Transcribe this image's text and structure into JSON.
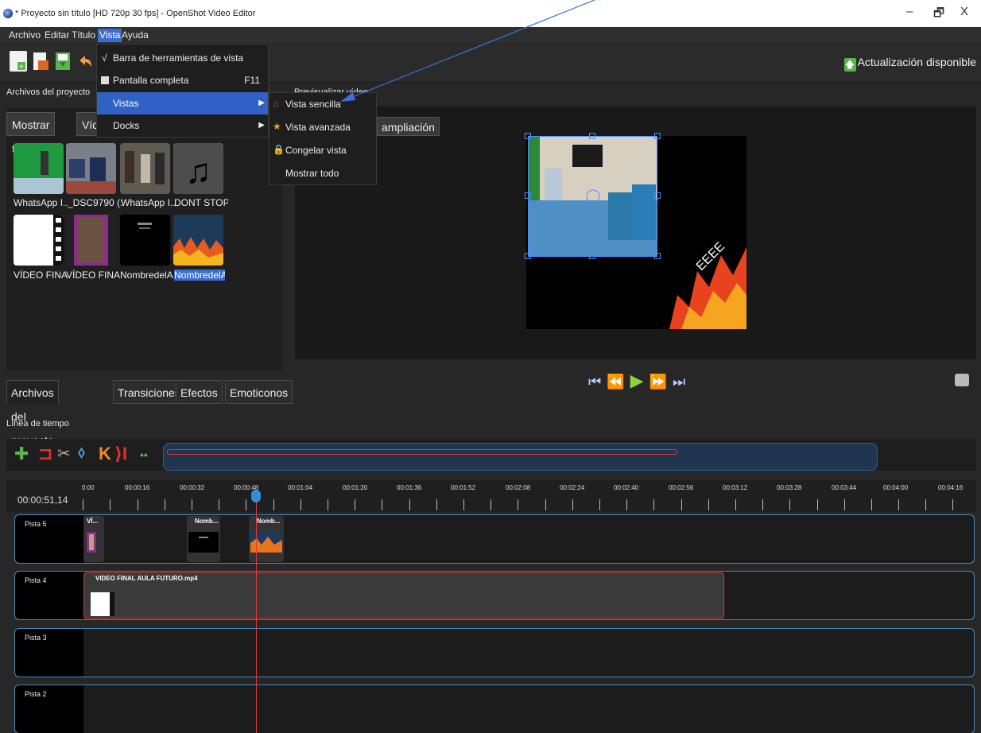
{
  "window": {
    "title": "* Proyecto sin título [HD 720p 30 fps] - OpenShot Video Editor",
    "minimize": "–",
    "restore": "🗗",
    "close": "X"
  },
  "menu": {
    "archivo": "Archivo",
    "editar": "Editar",
    "titulo": "Título",
    "vista": "Vista",
    "ayuda": "Ayuda"
  },
  "toolbar": {
    "update_label": "Actualización disponible"
  },
  "docks": {
    "project_files_title": "Archivos del proyecto",
    "preview_title": "Previsualizar vídeo",
    "timeline_title": "Línea de tiempo"
  },
  "filters": {
    "show_all": "Mostrar todo",
    "video": "Víde"
  },
  "files": [
    {
      "label": "WhatsApp I..."
    },
    {
      "label": "_DSC9790 (1..."
    },
    {
      "label": "WhatsApp I..."
    },
    {
      "label": "DONT STOP ..."
    },
    {
      "label": "VÍDEO FINAL..."
    },
    {
      "label": "VÍDEO FINAL..."
    },
    {
      "label": "NombredelA..."
    },
    {
      "label": "NombredelA..."
    }
  ],
  "bottom_tabs": {
    "project_files": "Archivos del proyecto",
    "transitions": "Transiciones",
    "effects": "Efectos",
    "emoticons": "Emoticonos"
  },
  "preview": {
    "zoom_label": "ampliación"
  },
  "vista_menu": {
    "toolbar_item": "Barra de herramientas de vista",
    "toolbar_check": "√",
    "fullscreen": "Pantalla completa",
    "fullscreen_shortcut": "F11",
    "views": "Vistas",
    "docks": "Docks"
  },
  "vistas_submenu": {
    "simple": "Vista sencilla",
    "advanced": "Vista avanzada",
    "freeze": "Congelar vista",
    "show_all": "Mostrar todo"
  },
  "timeline": {
    "current_time": "00:00:51,14",
    "ticks": [
      "0:00",
      "00:00:16",
      "00:00:32",
      "00:00:48",
      "00:01:04",
      "00:01:20",
      "00:01:36",
      "00:01:52",
      "00:02:08",
      "00:02:24",
      "00:02:40",
      "00:02:56",
      "00:03:12",
      "00:03:28",
      "00:03:44",
      "00:04:00",
      "00:04:16"
    ],
    "tracks": [
      {
        "name": "Pista 5"
      },
      {
        "name": "Pista 4"
      },
      {
        "name": "Pista 3"
      },
      {
        "name": "Pista 2"
      }
    ],
    "clips": {
      "t5_a": "VÍ...",
      "t5_b": "Nomb...",
      "t5_c": "Nomb...",
      "t4_main": "VIDEO FINAL AULA FUTURO.mp4"
    }
  },
  "colors": {
    "accent": "#2f62c4",
    "playhead": "#e03b3b",
    "track_border": "#4a89b8"
  }
}
